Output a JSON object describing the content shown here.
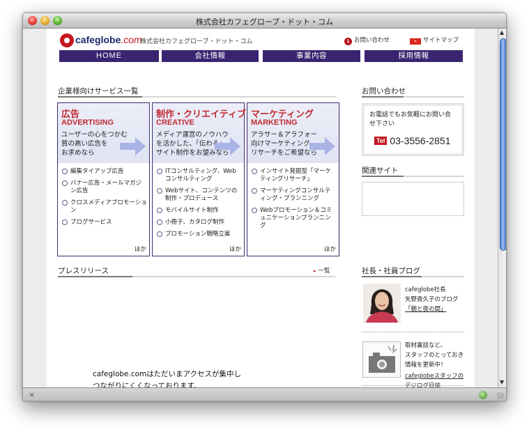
{
  "window": {
    "title": "株式会社カフェグローブ・ドット・コム"
  },
  "header": {
    "logo_main": "cafeglobe",
    "logo_suffix": ".com",
    "company_name": "株式会社カフェグローブ・ドット・コム",
    "contact_link": "お問い合わせ",
    "sitemap_link": "サイトマップ"
  },
  "nav": [
    "HOME",
    "会社情報",
    "事業内容",
    "採用情報"
  ],
  "services_section": {
    "heading": "企業様向けサービス一覧"
  },
  "services": [
    {
      "title_jp": "広告",
      "title_en": "ADVERTISING",
      "desc": [
        "ユーザーの心をつかむ",
        "質の高い広告を",
        "お求めなら"
      ],
      "items": [
        "編集タイアップ広告",
        "バナー広告・メールマガジン広告",
        "クロスメディアプロモーション",
        "ブログサービス"
      ],
      "more": "ほか"
    },
    {
      "title_jp": "制作・クリエイティブ",
      "title_en": "CREATIVE",
      "desc": [
        "メディア運営のノウハウ",
        "を活かした、「伝わる」",
        "サイト制作をお望みなら"
      ],
      "items": [
        "ITコンサルティング、Webコンサルティング",
        "Webサイト、コンテンツの制作・プロデュース",
        "モバイルサイト制作",
        "小冊子、カタログ制作",
        "プロモーション戦略立案"
      ],
      "more": "ほか"
    },
    {
      "title_jp": "マーケティング",
      "title_en": "MARKETING",
      "desc": [
        "アラサー＆アラフォー",
        "向けマーケティング",
        "リサーチをご希望なら"
      ],
      "items": [
        "インサイト発掘型「マーケティングリサーチ」",
        "マーケティングコンサルティング・プランニング",
        "Webプロモーション＆コミュニケーションプランニング"
      ],
      "more": "ほか"
    }
  ],
  "press": {
    "heading": "プレスリリース",
    "more": "一覧"
  },
  "notice": [
    "cafeglobe.comはただいまアクセスが集中し",
    "つながりにくくなっております。"
  ],
  "contact": {
    "heading": "お問い合わせ",
    "text": [
      "お電話でもお気軽にお問い合",
      "せ下さい"
    ],
    "tel_label": "Tel",
    "tel_number": "03-3556-2851"
  },
  "related": {
    "heading": "関連サイト"
  },
  "blog": {
    "heading": "社長・社員ブログ",
    "president_line1": "cafeglobe社長",
    "president_line2": "矢野貴久子のブログ",
    "president_link": "「朝と夜の間」",
    "staff_line1": "取材裏話など、",
    "staff_line2": "スタッフのとっておき",
    "staff_line3": "情報を更新中！",
    "staff_link1": "cafeglobeスタッフの",
    "staff_link2": "デジログ日誌"
  },
  "colors": {
    "nav": "#3a2470",
    "accent": "#c0292f",
    "box_border": "#3a2a6e"
  }
}
